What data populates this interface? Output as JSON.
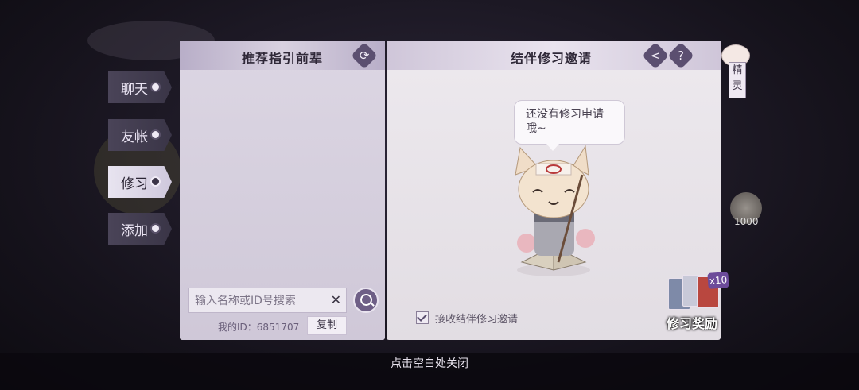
{
  "tabs": [
    {
      "label": "聊天",
      "active": false
    },
    {
      "label": "友帐",
      "active": false
    },
    {
      "label": "修习",
      "active": true
    },
    {
      "label": "添加",
      "active": false
    }
  ],
  "left_panel": {
    "title": "推荐指引前辈",
    "refresh_icon": "refresh-icon",
    "search_placeholder": "输入名称或ID号搜索",
    "clear_symbol": "✕",
    "my_id_label": "我的ID：6851707",
    "copy_label": "复制"
  },
  "right_panel": {
    "title": "结伴修习邀请",
    "share_icon": "share-icon",
    "help_icon": "help-icon",
    "help_symbol": "?",
    "share_symbol": "<",
    "empty_message": "还没有修习申请哦~",
    "accept_label": "接收结伴修习邀请",
    "accept_checked": true
  },
  "sprite": {
    "label": "精灵"
  },
  "reward": {
    "label": "修习奖励",
    "count": "x10"
  },
  "background": {
    "coin_value": "1000"
  },
  "footer": {
    "close_hint": "点击空白处关闭"
  },
  "colors": {
    "accent": "#5b4f70",
    "panel": "#dcd6e3"
  }
}
